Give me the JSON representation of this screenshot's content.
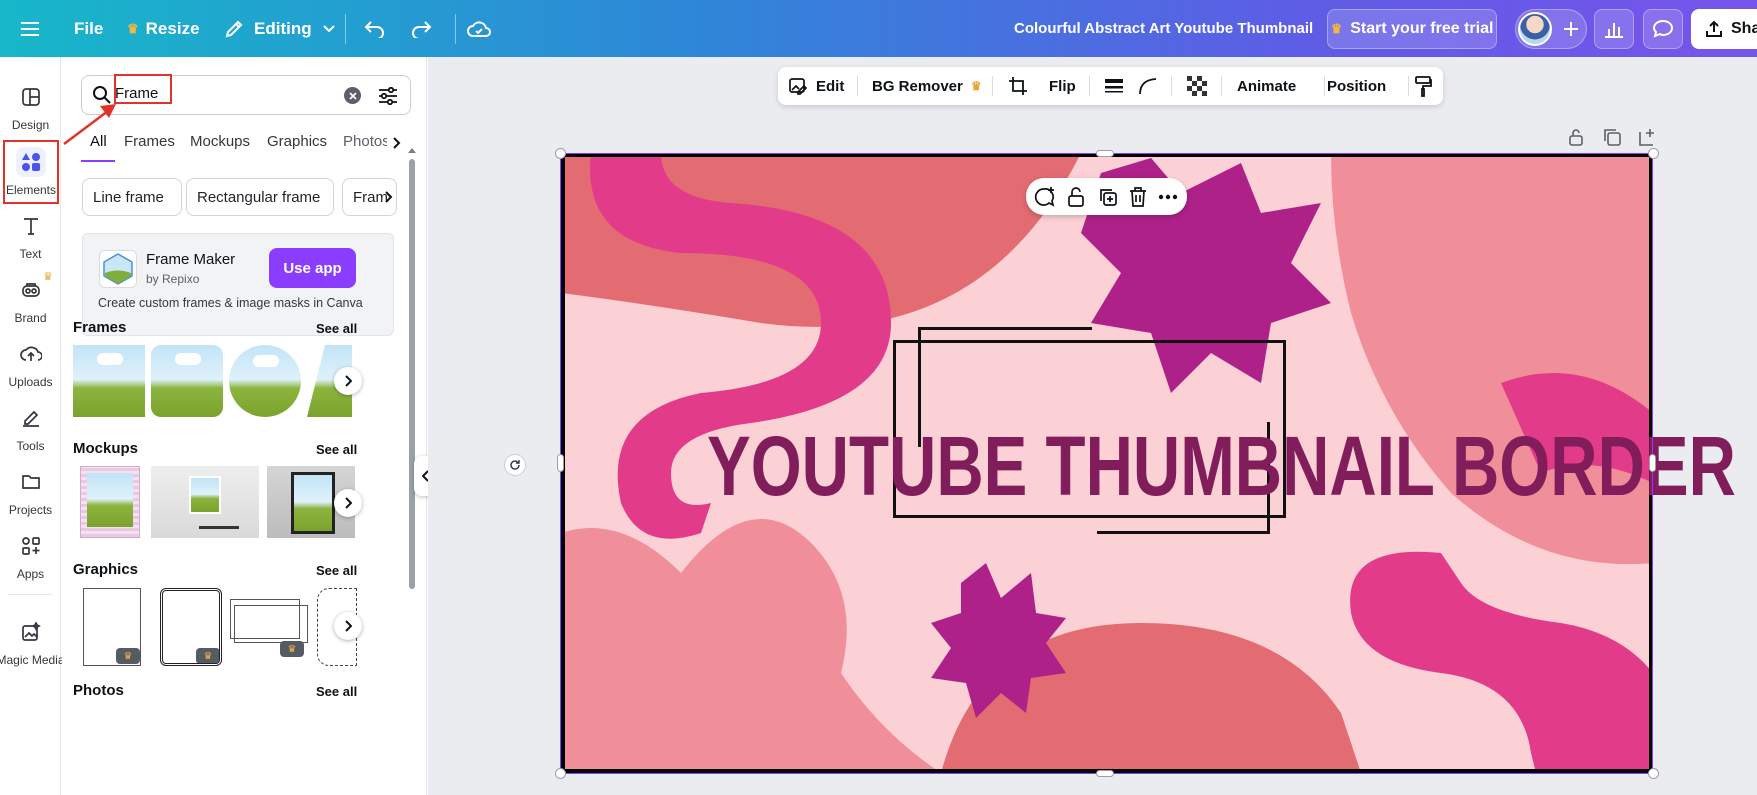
{
  "topbar": {
    "file_label": "File",
    "resize_label": "Resize",
    "editing_label": "Editing",
    "doc_title": "Colourful Abstract Art Youtube Thumbnail",
    "trial_label": "Start your free trial",
    "share_label": "Sha"
  },
  "rail": {
    "design": "Design",
    "elements": "Elements",
    "text": "Text",
    "brand": "Brand",
    "uploads": "Uploads",
    "tools": "Tools",
    "projects": "Projects",
    "apps": "Apps",
    "magic_media": "Magic Media"
  },
  "search": {
    "value": "Frame"
  },
  "tabs": [
    "All",
    "Frames",
    "Mockups",
    "Graphics",
    "Photos"
  ],
  "chips": [
    "Line frame",
    "Rectangular frame",
    "Fram"
  ],
  "app_card": {
    "name": "Frame Maker",
    "by": "by Repixo",
    "button": "Use app",
    "description": "Create custom frames & image masks in Canva"
  },
  "sections": {
    "frames": "Frames",
    "mockups": "Mockups",
    "graphics": "Graphics",
    "photos": "Photos",
    "see_all": "See all"
  },
  "context_toolbar": {
    "edit": "Edit",
    "bg_remover": "BG Remover",
    "flip": "Flip",
    "animate": "Animate",
    "position": "Position"
  },
  "design": {
    "headline": "YOUTUBE THUMBNAIL BORDER"
  },
  "colors": {
    "accent": "#8b3dff",
    "highlight_red": "#e2332b",
    "headline": "#821d5b",
    "background_pink": "#fbd1d6"
  }
}
